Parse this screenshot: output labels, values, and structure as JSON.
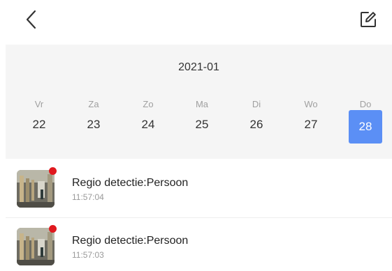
{
  "header": {
    "back_icon": "chevron-left-icon",
    "edit_icon": "edit-icon"
  },
  "calendar": {
    "month": "2021-01",
    "days": [
      {
        "name": "Vr",
        "num": "22",
        "selected": false
      },
      {
        "name": "Za",
        "num": "23",
        "selected": false
      },
      {
        "name": "Zo",
        "num": "24",
        "selected": false
      },
      {
        "name": "Ma",
        "num": "25",
        "selected": false
      },
      {
        "name": "Di",
        "num": "26",
        "selected": false
      },
      {
        "name": "Wo",
        "num": "27",
        "selected": false
      },
      {
        "name": "Do",
        "num": "28",
        "selected": true
      }
    ],
    "selected_color": "#5b8ff5"
  },
  "events": [
    {
      "title": "Regio detectie:Persoon",
      "time": "11:57:04",
      "unread": true
    },
    {
      "title": "Regio detectie:Persoon",
      "time": "11:57:03",
      "unread": true
    }
  ],
  "colors": {
    "unread_dot": "#e0191e",
    "calendar_bg": "#f5f5f5"
  }
}
